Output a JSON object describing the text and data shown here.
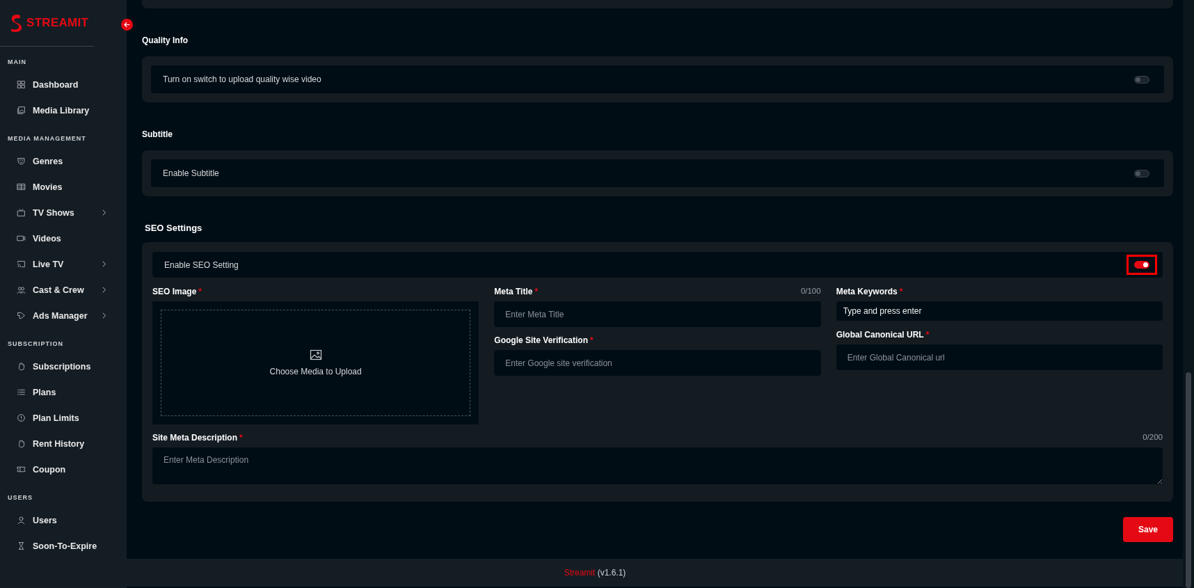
{
  "sidebar": {
    "brand": "STREAMIT",
    "sections": [
      {
        "title": "MAIN",
        "items": [
          {
            "label": "Dashboard",
            "expandable": false
          },
          {
            "label": "Media Library",
            "expandable": false
          }
        ]
      },
      {
        "title": "MEDIA MANAGEMENT",
        "items": [
          {
            "label": "Genres",
            "expandable": false
          },
          {
            "label": "Movies",
            "expandable": false
          },
          {
            "label": "TV Shows",
            "expandable": true
          },
          {
            "label": "Videos",
            "expandable": false
          },
          {
            "label": "Live TV",
            "expandable": true
          },
          {
            "label": "Cast & Crew",
            "expandable": true
          },
          {
            "label": "Ads Manager",
            "expandable": true
          }
        ]
      },
      {
        "title": "SUBSCRIPTION",
        "items": [
          {
            "label": "Subscriptions",
            "expandable": false
          },
          {
            "label": "Plans",
            "expandable": false
          },
          {
            "label": "Plan Limits",
            "expandable": false
          },
          {
            "label": "Rent History",
            "expandable": false
          },
          {
            "label": "Coupon",
            "expandable": false
          }
        ]
      },
      {
        "title": "USERS",
        "items": [
          {
            "label": "Users",
            "expandable": false
          },
          {
            "label": "Soon-To-Expire",
            "expandable": false
          }
        ]
      }
    ]
  },
  "settings": [
    {
      "title": "Quality Info",
      "toggle_label": "Turn on switch to upload quality wise video",
      "on": false
    },
    {
      "title": "Subtitle",
      "toggle_label": "Enable Subtitle",
      "on": false
    }
  ],
  "seo": {
    "title": "SEO Settings",
    "toggle_label": "Enable SEO Setting",
    "on": true,
    "highlighted": true,
    "image": {
      "label": "SEO Image",
      "required_mark": "*",
      "prompt": "Choose Media to Upload"
    },
    "fields": [
      {
        "kind": "text",
        "label": "Meta Title",
        "required_mark": "*",
        "counter": "0/100",
        "placeholder": "Enter Meta Title"
      },
      {
        "kind": "text",
        "label": "Google Site Verification",
        "required_mark": "*",
        "placeholder": "Enter Google site verification"
      },
      {
        "kind": "tags",
        "label": "Meta Keywords",
        "required_mark": "*",
        "placeholder": "Type and press enter"
      },
      {
        "kind": "text",
        "label": "Global Canonical URL",
        "required_mark": "*",
        "placeholder": "Enter Global Canonical url"
      }
    ],
    "description": {
      "label": "Site Meta Description",
      "required_mark": "*",
      "counter": "0/200",
      "placeholder": "Enter Meta Description"
    }
  },
  "save_button": "Save",
  "footer": {
    "brand": "Streamit",
    "version": "(v1.6.1)"
  }
}
